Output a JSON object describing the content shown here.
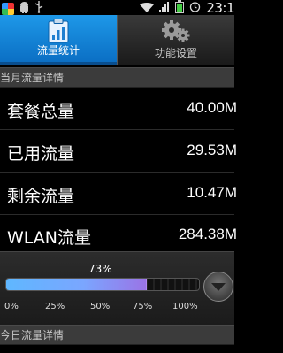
{
  "status_bar": {
    "time": "23:1",
    "icons": [
      "app-badge-icon",
      "android-icon",
      "usb-icon",
      "wifi-icon",
      "signal-icon",
      "battery-icon",
      "alarm-icon"
    ]
  },
  "tabs": [
    {
      "label": "流量统计",
      "icon": "bar-chart-icon",
      "selected": true
    },
    {
      "label": "功能设置",
      "icon": "gears-icon",
      "selected": false
    }
  ],
  "monthly": {
    "header": "当月流量详情",
    "rows": [
      {
        "label": "套餐总量",
        "value": "40.00M"
      },
      {
        "label": "已用流量",
        "value": "29.53M"
      },
      {
        "label": "剩余流量",
        "value": "10.47M"
      },
      {
        "label": "WLAN流量",
        "value": "284.38M"
      }
    ]
  },
  "usage": {
    "percent_text": "73%",
    "fraction": 0.73,
    "scale": [
      "0%",
      "25%",
      "50%",
      "75%",
      "100%"
    ]
  },
  "today": {
    "header": "今日流量详情"
  },
  "colors": {
    "accent": "#1e98e8",
    "fill_start": "#5fb7ff",
    "fill_end": "#9a74e6"
  }
}
